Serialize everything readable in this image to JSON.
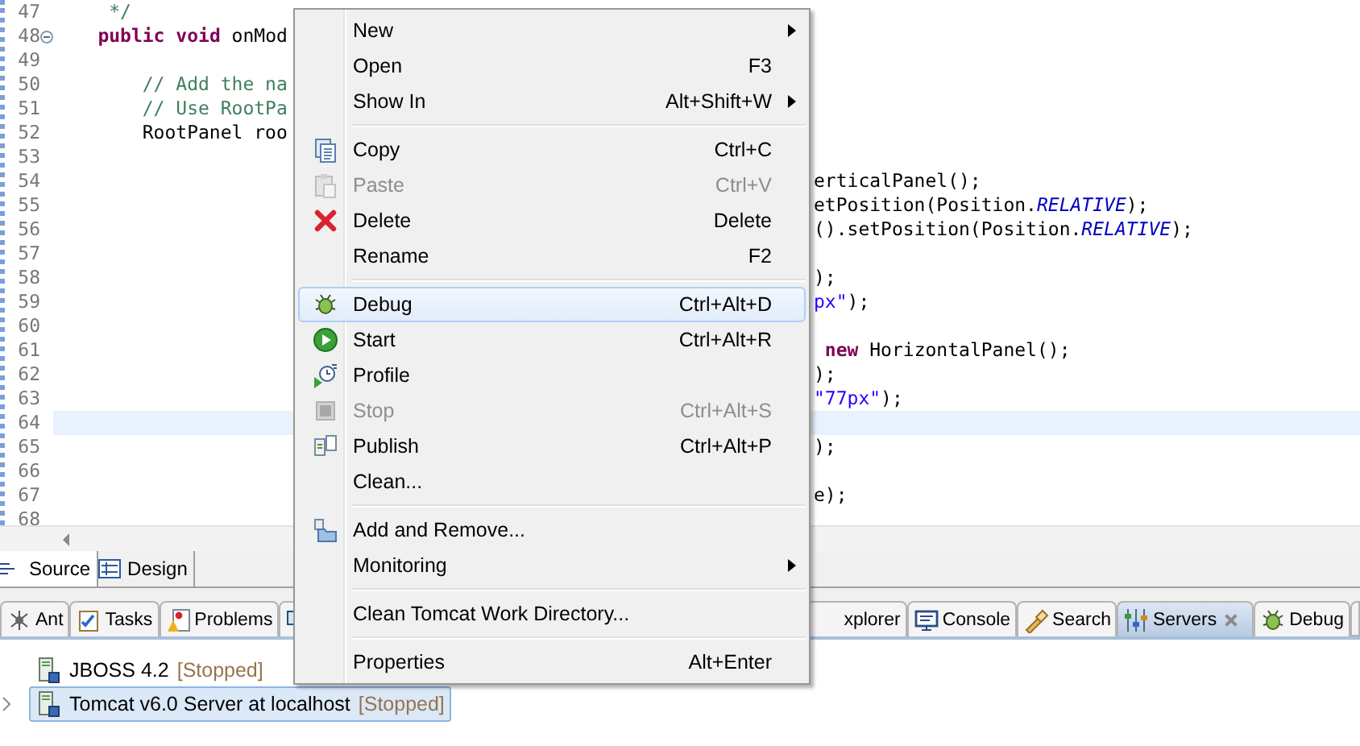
{
  "editor": {
    "lines": [
      {
        "number": "47",
        "fold": false,
        "current": false,
        "left": [
          {
            "kind": "comment",
            "text": "     */"
          }
        ]
      },
      {
        "number": "48",
        "fold": true,
        "current": false,
        "left": [
          {
            "kind": "keyword",
            "text": "    public"
          },
          {
            "kind": "keyword",
            "text": " void"
          },
          {
            "kind": "plain",
            "text": " onMod"
          }
        ]
      },
      {
        "number": "49",
        "fold": false,
        "current": false
      },
      {
        "number": "50",
        "fold": false,
        "current": false,
        "left": [
          {
            "kind": "comment",
            "text": "        // Add the na"
          }
        ]
      },
      {
        "number": "51",
        "fold": false,
        "current": false,
        "left": [
          {
            "kind": "comment",
            "text": "        // Use RootPa"
          }
        ]
      },
      {
        "number": "52",
        "fold": false,
        "current": false,
        "left": [
          {
            "kind": "plain",
            "text": "        RootPanel roo"
          }
        ]
      },
      {
        "number": "53",
        "fold": false,
        "current": false
      },
      {
        "number": "54",
        "fold": false,
        "current": false,
        "right": [
          {
            "kind": "plain",
            "text": "erticalPanel();"
          }
        ]
      },
      {
        "number": "55",
        "fold": false,
        "current": false,
        "right": [
          {
            "kind": "plain",
            "text": "etPosition(Position."
          },
          {
            "kind": "constant",
            "text": "RELATIVE"
          },
          {
            "kind": "plain",
            "text": ");"
          }
        ]
      },
      {
        "number": "56",
        "fold": false,
        "current": false,
        "right": [
          {
            "kind": "plain",
            "text": "().setPosition(Position."
          },
          {
            "kind": "constant",
            "text": "RELATIVE"
          },
          {
            "kind": "plain",
            "text": ");"
          }
        ]
      },
      {
        "number": "57",
        "fold": false,
        "current": false
      },
      {
        "number": "58",
        "fold": false,
        "current": false,
        "right": [
          {
            "kind": "plain",
            "text": ");"
          }
        ]
      },
      {
        "number": "59",
        "fold": false,
        "current": false,
        "right": [
          {
            "kind": "string",
            "text": "px\""
          },
          {
            "kind": "plain",
            "text": ");"
          }
        ]
      },
      {
        "number": "60",
        "fold": false,
        "current": false
      },
      {
        "number": "61",
        "fold": false,
        "current": false,
        "right": [
          {
            "kind": "keyword",
            "text": " new"
          },
          {
            "kind": "plain",
            "text": " HorizontalPanel();"
          }
        ]
      },
      {
        "number": "62",
        "fold": false,
        "current": false,
        "right": [
          {
            "kind": "plain",
            "text": ");"
          }
        ]
      },
      {
        "number": "63",
        "fold": false,
        "current": false,
        "right": [
          {
            "kind": "string",
            "text": "\"77px\""
          },
          {
            "kind": "plain",
            "text": ");"
          }
        ]
      },
      {
        "number": "64",
        "fold": false,
        "current": true
      },
      {
        "number": "65",
        "fold": false,
        "current": false,
        "right": [
          {
            "kind": "plain",
            "text": ");"
          }
        ]
      },
      {
        "number": "66",
        "fold": false,
        "current": false
      },
      {
        "number": "67",
        "fold": false,
        "current": false,
        "right": [
          {
            "kind": "plain",
            "text": "e);"
          }
        ]
      },
      {
        "number": "68",
        "fold": false,
        "current": false
      }
    ]
  },
  "editor_tabs": [
    {
      "label": "Source",
      "selected": true
    },
    {
      "label": "Design",
      "selected": false
    }
  ],
  "view_tabs": [
    {
      "label": "Ant",
      "selected": false,
      "closable": false
    },
    {
      "label": "Tasks",
      "selected": false,
      "closable": false
    },
    {
      "label": "Problems",
      "selected": false,
      "closable": false
    },
    {
      "label": "xplorer",
      "selected": false,
      "closable": false
    },
    {
      "label": "Console",
      "selected": false,
      "closable": false
    },
    {
      "label": "Search",
      "selected": false,
      "closable": false
    },
    {
      "label": "Servers",
      "selected": true,
      "closable": true
    },
    {
      "label": "Debug",
      "selected": false,
      "closable": false
    }
  ],
  "servers": [
    {
      "name": "JBOSS 4.2",
      "status": "[Stopped]",
      "selected": false,
      "expandable": false
    },
    {
      "name": "Tomcat v6.0 Server at localhost",
      "status": "[Stopped]",
      "selected": true,
      "expandable": true
    }
  ],
  "context_menu": {
    "groups": [
      [
        {
          "label": "New",
          "submenu": true,
          "disabled": false,
          "selected": false
        },
        {
          "label": "Open",
          "shortcut": "F3",
          "submenu": false,
          "disabled": false,
          "selected": false
        },
        {
          "label": "Show In",
          "shortcut": "Alt+Shift+W",
          "submenu": true,
          "disabled": false,
          "selected": false
        }
      ],
      [
        {
          "label": "Copy",
          "shortcut": "Ctrl+C",
          "submenu": false,
          "disabled": false,
          "selected": false
        },
        {
          "label": "Paste",
          "shortcut": "Ctrl+V",
          "submenu": false,
          "disabled": true,
          "selected": false
        },
        {
          "label": "Delete",
          "shortcut": "Delete",
          "submenu": false,
          "disabled": false,
          "selected": false
        },
        {
          "label": "Rename",
          "shortcut": "F2",
          "submenu": false,
          "disabled": false,
          "selected": false
        }
      ],
      [
        {
          "label": "Debug",
          "shortcut": "Ctrl+Alt+D",
          "submenu": false,
          "disabled": false,
          "selected": true
        },
        {
          "label": "Start",
          "shortcut": "Ctrl+Alt+R",
          "submenu": false,
          "disabled": false,
          "selected": false
        },
        {
          "label": "Profile",
          "submenu": false,
          "disabled": false,
          "selected": false
        },
        {
          "label": "Stop",
          "shortcut": "Ctrl+Alt+S",
          "submenu": false,
          "disabled": true,
          "selected": false
        },
        {
          "label": "Publish",
          "shortcut": "Ctrl+Alt+P",
          "submenu": false,
          "disabled": false,
          "selected": false
        },
        {
          "label": "Clean...",
          "submenu": false,
          "disabled": false,
          "selected": false
        }
      ],
      [
        {
          "label": "Add and Remove...",
          "submenu": false,
          "disabled": false,
          "selected": false
        },
        {
          "label": "Monitoring",
          "submenu": true,
          "disabled": false,
          "selected": false
        }
      ],
      [
        {
          "label": "Clean Tomcat Work Directory...",
          "submenu": false,
          "disabled": false,
          "selected": false
        }
      ],
      [
        {
          "label": "Properties",
          "shortcut": "Alt+Enter",
          "submenu": false,
          "disabled": false,
          "selected": false
        }
      ]
    ]
  }
}
